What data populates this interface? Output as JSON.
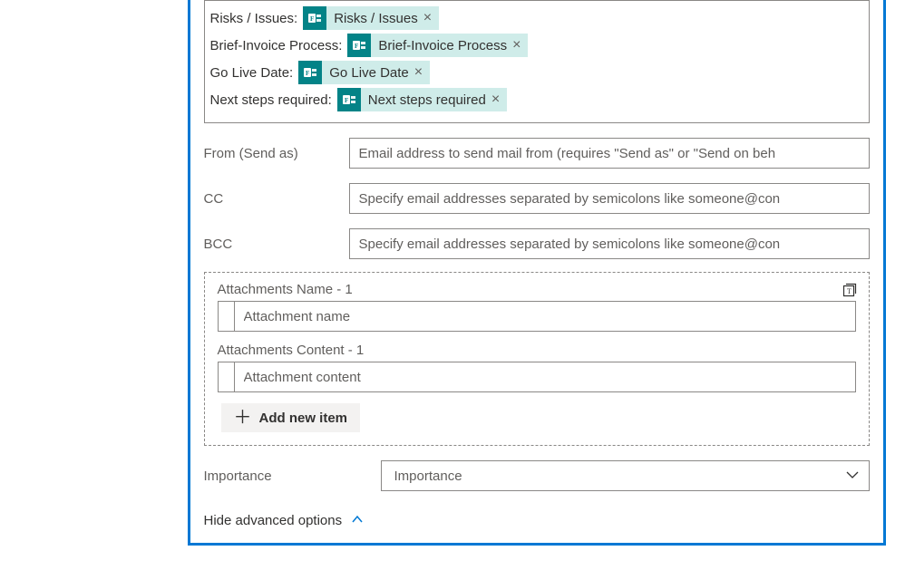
{
  "colors": {
    "accent": "#0078d4",
    "teal": "#038387",
    "tealLight": "#cfece9"
  },
  "tokens": [
    {
      "label": "Risks / Issues:",
      "value": "Risks / Issues"
    },
    {
      "label": "Brief-Invoice Process:",
      "value": "Brief-Invoice Process"
    },
    {
      "label": "Go Live Date:",
      "value": "Go Live Date"
    },
    {
      "label": "Next steps required:",
      "value": "Next steps required"
    }
  ],
  "fields": {
    "from": {
      "label": "From (Send as)",
      "placeholder": "Email address to send mail from (requires \"Send as\" or \"Send on beh"
    },
    "cc": {
      "label": "CC",
      "placeholder": "Specify email addresses separated by semicolons like someone@con"
    },
    "bcc": {
      "label": "BCC",
      "placeholder": "Specify email addresses separated by semicolons like someone@con"
    }
  },
  "attachments": {
    "nameTitle": "Attachments Name - 1",
    "namePlaceholder": "Attachment name",
    "contentTitle": "Attachments Content - 1",
    "contentPlaceholder": "Attachment content",
    "addItemLabel": "Add new item"
  },
  "importance": {
    "label": "Importance",
    "placeholder": "Importance"
  },
  "hideAdvancedLabel": "Hide advanced options"
}
